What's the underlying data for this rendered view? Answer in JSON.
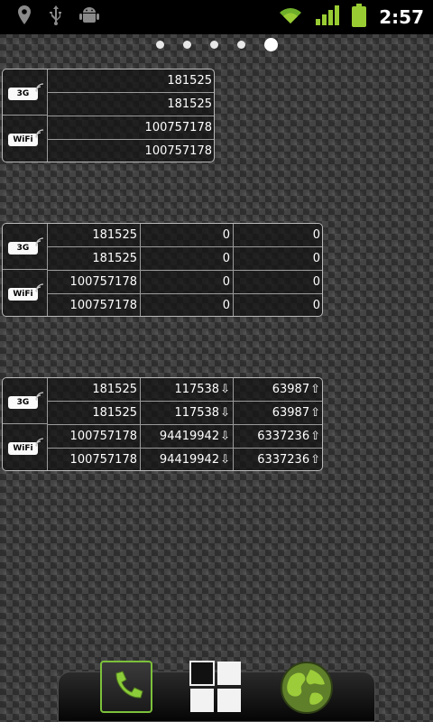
{
  "status_bar": {
    "left_icons": [
      "location-icon",
      "usb-icon",
      "android-debug-icon"
    ],
    "right_icons": [
      "wifi-icon",
      "signal-icon",
      "battery-icon"
    ],
    "time": "2:57",
    "accent_color": "#99cc33"
  },
  "page_indicator": {
    "pages": 5,
    "current": 5
  },
  "widgets": [
    {
      "networks": [
        {
          "label": "3G"
        },
        {
          "label": "WiFi"
        }
      ],
      "rows": [
        {
          "total": "181525"
        },
        {
          "total": "181525"
        },
        {
          "total": "100757178"
        },
        {
          "total": "100757178"
        }
      ]
    },
    {
      "networks": [
        {
          "label": "3G"
        },
        {
          "label": "WiFi"
        }
      ],
      "rows": [
        {
          "total": "181525",
          "down": "0",
          "up": "0"
        },
        {
          "total": "181525",
          "down": "0",
          "up": "0"
        },
        {
          "total": "100757178",
          "down": "0",
          "up": "0"
        },
        {
          "total": "100757178",
          "down": "0",
          "up": "0"
        }
      ]
    },
    {
      "networks": [
        {
          "label": "3G"
        },
        {
          "label": "WiFi"
        }
      ],
      "rows": [
        {
          "total": "181525",
          "down": "117538",
          "up": "63987"
        },
        {
          "total": "181525",
          "down": "117538",
          "up": "63987"
        },
        {
          "total": "100757178",
          "down": "94419942",
          "up": "6337236"
        },
        {
          "total": "100757178",
          "down": "94419942",
          "up": "6337236"
        }
      ],
      "down_arrow": "⇩",
      "up_arrow": "⇧"
    }
  ],
  "dock": {
    "items": [
      "phone-icon",
      "app-drawer-icon",
      "browser-globe-icon"
    ]
  }
}
